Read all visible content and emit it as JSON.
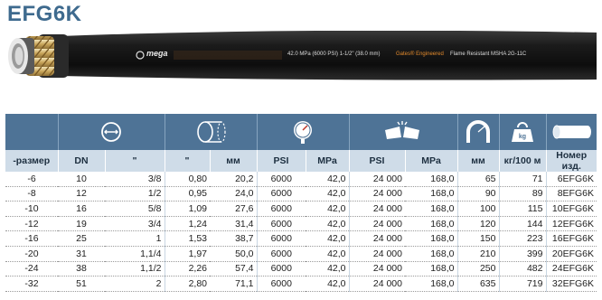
{
  "title": "EFG6K",
  "hose": {
    "brand": "mega",
    "spec_text": "42.0 MPa (6000 PSI) 1-1/2\" (38.0 mm)",
    "engineered_text": "Gates® Engineered",
    "rating_text": "Flame Resistant MSHA 2G-11C"
  },
  "table": {
    "columns": [
      "-размер",
      "DN",
      "\"",
      "\"",
      "мм",
      "PSI",
      "MPa",
      "PSI",
      "MPa",
      "мм",
      "кг/100 м",
      "Номер изд."
    ],
    "rows": [
      [
        "-6",
        "10",
        "3/8",
        "0,80",
        "20,2",
        "6000",
        "42,0",
        "24 000",
        "168,0",
        "65",
        "71",
        "6EFG6K"
      ],
      [
        "-8",
        "12",
        "1/2",
        "0,95",
        "24,0",
        "6000",
        "42,0",
        "24 000",
        "168,0",
        "90",
        "89",
        "8EFG6K"
      ],
      [
        "-10",
        "16",
        "5/8",
        "1,09",
        "27,6",
        "6000",
        "42,0",
        "24 000",
        "168,0",
        "100",
        "115",
        "10EFG6K"
      ],
      [
        "-12",
        "19",
        "3/4",
        "1,24",
        "31,4",
        "6000",
        "42,0",
        "24 000",
        "168,0",
        "120",
        "144",
        "12EFG6K"
      ],
      [
        "-16",
        "25",
        "1",
        "1,53",
        "38,7",
        "6000",
        "42,0",
        "24 000",
        "168,0",
        "150",
        "223",
        "16EFG6K"
      ],
      [
        "-20",
        "31",
        "1,1/4",
        "1,97",
        "50,0",
        "6000",
        "42,0",
        "24 000",
        "168,0",
        "210",
        "399",
        "20EFG6K"
      ],
      [
        "-24",
        "38",
        "1,1/2",
        "2,26",
        "57,4",
        "6000",
        "42,0",
        "24 000",
        "168,0",
        "250",
        "482",
        "24EFG6K"
      ],
      [
        "-32",
        "51",
        "2",
        "2,80",
        "71,1",
        "6000",
        "42,0",
        "24 000",
        "168,0",
        "635",
        "719",
        "32EFG6K"
      ]
    ],
    "icon_weight_label": "kg"
  },
  "colors": {
    "title": "#3e6a8e",
    "icon_header_bg": "#4e7396",
    "column_header_bg": "#cfdce8"
  }
}
